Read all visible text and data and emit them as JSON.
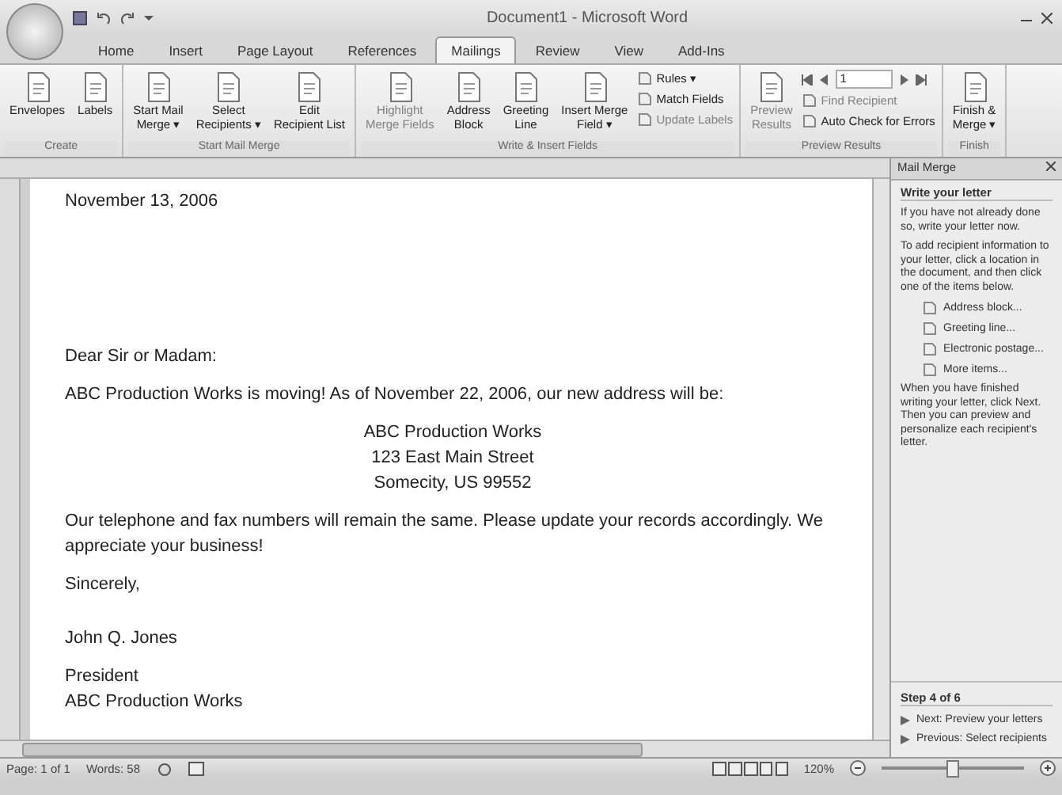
{
  "window": {
    "title": "Document1 - Microsoft Word"
  },
  "tabs": [
    {
      "label": "Home",
      "selected": false
    },
    {
      "label": "Insert",
      "selected": false
    },
    {
      "label": "Page Layout",
      "selected": false
    },
    {
      "label": "References",
      "selected": false
    },
    {
      "label": "Mailings",
      "selected": true
    },
    {
      "label": "Review",
      "selected": false
    },
    {
      "label": "View",
      "selected": false
    },
    {
      "label": "Add-Ins",
      "selected": false
    }
  ],
  "ribbon": [
    {
      "label": "Create",
      "buttons": [
        {
          "kind": "large",
          "label": "Envelopes",
          "disabled": false
        },
        {
          "kind": "large",
          "label": "Labels",
          "disabled": false
        }
      ]
    },
    {
      "label": "Start Mail Merge",
      "buttons": [
        {
          "kind": "large",
          "label": "Start Mail\nMerge ▾",
          "disabled": false
        },
        {
          "kind": "large",
          "label": "Select\nRecipients ▾",
          "disabled": false
        },
        {
          "kind": "large",
          "label": "Edit\nRecipient List",
          "disabled": false
        }
      ]
    },
    {
      "label": "Write & Insert Fields",
      "buttons": [
        {
          "kind": "large",
          "label": "Highlight\nMerge Fields",
          "disabled": true
        },
        {
          "kind": "large",
          "label": "Address\nBlock",
          "disabled": false
        },
        {
          "kind": "large",
          "label": "Greeting\nLine",
          "disabled": false
        },
        {
          "kind": "large",
          "label": "Insert Merge\nField ▾",
          "disabled": false
        },
        {
          "kind": "small",
          "label": "Rules ▾",
          "disabled": false
        },
        {
          "kind": "small",
          "label": "Match Fields",
          "disabled": false
        },
        {
          "kind": "small",
          "label": "Update Labels",
          "disabled": true
        }
      ]
    },
    {
      "label": "Preview Results",
      "buttons": [
        {
          "kind": "large",
          "label": "Preview\nResults",
          "disabled": true
        },
        {
          "kind": "nav",
          "label": "1",
          "disabled": false
        },
        {
          "kind": "small",
          "label": "Find Recipient",
          "disabled": true
        },
        {
          "kind": "small",
          "label": "Auto Check for Errors",
          "disabled": false
        }
      ]
    },
    {
      "label": "Finish",
      "buttons": [
        {
          "kind": "large",
          "label": "Finish &\nMerge ▾",
          "disabled": false
        }
      ]
    }
  ],
  "letter": {
    "date": "November 13, 2006",
    "salutation": "Dear Sir or Madam:",
    "announcement": "ABC Production Works is moving!  As of November 22, 2006, our new address will be:",
    "address": [
      "ABC Production Works",
      "123 East Main Street",
      "Somecity, US 99552"
    ],
    "body": "Our telephone and fax numbers will remain the same. Please update your records accordingly. We appreciate your business!",
    "closing": "Sincerely,",
    "signer": "John Q. Jones",
    "signer_title": "President",
    "company": "ABC Production Works"
  },
  "task_pane": {
    "title": "Mail Merge",
    "heading": "Write your letter",
    "paragraphs": [
      "If you have not already done so, write your letter now.",
      "To add recipient information to your letter, click a location in the document, and then click one of the items below."
    ],
    "items": [
      "Address block...",
      "Greeting line...",
      "Electronic postage...",
      "More items..."
    ],
    "note": "When you have finished writing your letter, click Next. Then you can preview and personalize each recipient's letter.",
    "step": "Step 4 of 6",
    "links": [
      "Next: Preview your letters",
      "Previous: Select recipients"
    ]
  },
  "status_bar": {
    "page": "Page: 1 of 1",
    "words": "Words: 58",
    "zoom": "120%",
    "zoom_slider": {
      "level": 0.5
    }
  }
}
